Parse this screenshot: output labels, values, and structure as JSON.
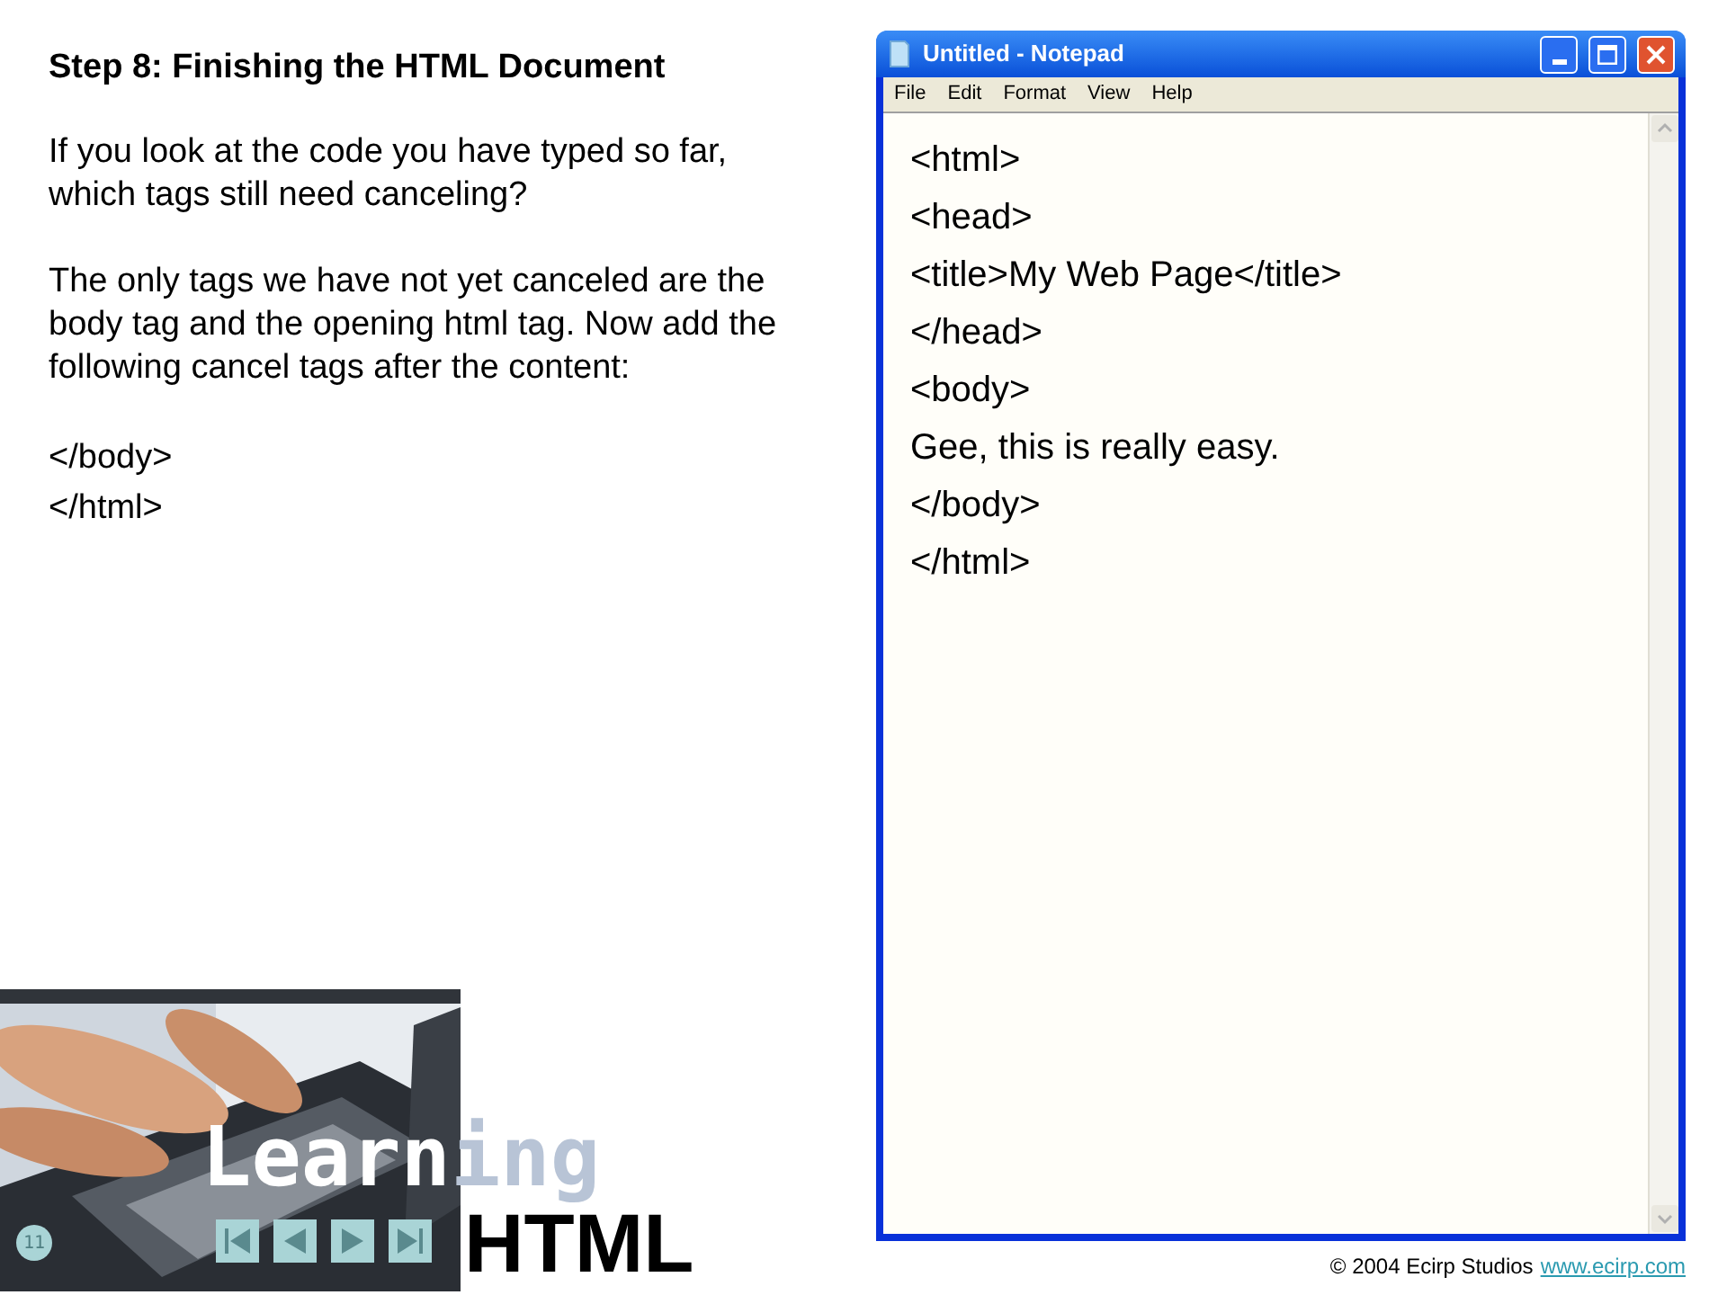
{
  "slide": {
    "heading": "Step 8: Finishing the HTML Document",
    "paragraphs": [
      "If you look at the code you have typed so far, which tags still need canceling?",
      "The only tags we have not yet canceled are the body tag and the opening html tag. Now add the following cancel tags after the content:"
    ],
    "code_lines": [
      "</body>",
      "</html>"
    ]
  },
  "banner": {
    "kind": "picture",
    "word_1": "Learning",
    "word_2": "HTML",
    "slide_number": "11",
    "nav_buttons": [
      {
        "kind": "first"
      },
      {
        "kind": "previous"
      },
      {
        "kind": "next"
      },
      {
        "kind": "last"
      }
    ]
  },
  "notepad": {
    "title": "Untitled - Notepad",
    "menu": [
      "File",
      "Edit",
      "Format",
      "View",
      "Help"
    ],
    "lines": [
      "<html>",
      "<head>",
      "<title>My Web Page</title>",
      "</head>",
      "<body>",
      "Gee, this is really easy.",
      "</body>",
      "</html>"
    ]
  },
  "footer": {
    "copyright": "© 2004 Ecirp Studios",
    "link": "www.ecirp.com"
  }
}
